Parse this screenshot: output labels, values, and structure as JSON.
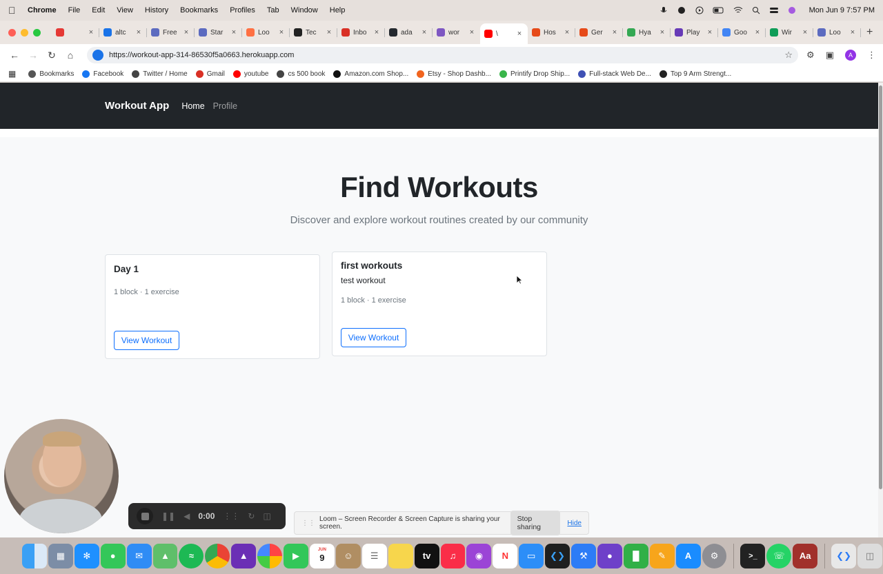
{
  "menubar": {
    "items": [
      "Chrome",
      "File",
      "Edit",
      "View",
      "History",
      "Bookmarks",
      "Profiles",
      "Tab",
      "Window",
      "Help"
    ],
    "clock": "Mon Jun 9  7:57 PM"
  },
  "tabs": [
    {
      "label": "",
      "color": "#e53935"
    },
    {
      "label": "altc",
      "color": "#1a73e8"
    },
    {
      "label": "Free",
      "color": "#5c6bc0"
    },
    {
      "label": "Star",
      "color": "#5c6bc0"
    },
    {
      "label": "Loo",
      "color": "#ff7043"
    },
    {
      "label": "Tec",
      "color": "#222222"
    },
    {
      "label": "Inbo",
      "color": "#d93025"
    },
    {
      "label": "ada",
      "color": "#24292f"
    },
    {
      "label": "wor",
      "color": "#7e57c2"
    },
    {
      "label": "\\",
      "color": "#ff0000"
    },
    {
      "label": "Hos",
      "color": "#e64a19"
    },
    {
      "label": "Ger",
      "color": "#e64a19"
    },
    {
      "label": "Hya",
      "color": "#34a853"
    },
    {
      "label": "Play",
      "color": "#673ab7"
    },
    {
      "label": "Goo",
      "color": "#4285f4"
    },
    {
      "label": "Wir",
      "color": "#0f9d58"
    },
    {
      "label": "Loo",
      "color": "#5c6bc0"
    }
  ],
  "omnibox": {
    "url": "https://workout-app-314-86530f5a0663.herokuapp.com"
  },
  "bookmarks": [
    {
      "label": "Bookmarks",
      "color": "#555555"
    },
    {
      "label": "Facebook",
      "color": "#1877f2"
    },
    {
      "label": "Twitter / Home",
      "color": "#444444"
    },
    {
      "label": "Gmail",
      "color": "#d93025"
    },
    {
      "label": "youtube",
      "color": "#ff0000"
    },
    {
      "label": "cs 500 book",
      "color": "#444444"
    },
    {
      "label": "Amazon.com Shop...",
      "color": "#111111"
    },
    {
      "label": "Etsy - Shop Dashb...",
      "color": "#f1641e"
    },
    {
      "label": "Printify Drop Ship...",
      "color": "#39b54a"
    },
    {
      "label": "Full-stack Web De...",
      "color": "#3f51b5"
    },
    {
      "label": "Top 9 Arm Strengt...",
      "color": "#222222"
    }
  ],
  "app": {
    "brand": "Workout App",
    "nav": [
      "Home",
      "Profile"
    ],
    "title": "Find Workouts",
    "subtitle": "Discover and explore workout routines created by our community",
    "cards": [
      {
        "title": "Day 1",
        "description": "",
        "meta": "1 block · 1 exercise",
        "button": "View Workout"
      },
      {
        "title": "first workouts",
        "description": "test workout",
        "meta": "1 block · 1 exercise",
        "button": "View Workout"
      }
    ]
  },
  "loom": {
    "timer": "0:00",
    "share_text": "Loom – Screen Recorder & Screen Capture is sharing your screen.",
    "stop_label": "Stop sharing",
    "hide_label": "Hide"
  },
  "dock": {
    "calendar_month": "JUN",
    "calendar_day": "9",
    "dictionary_label": "Aa"
  }
}
